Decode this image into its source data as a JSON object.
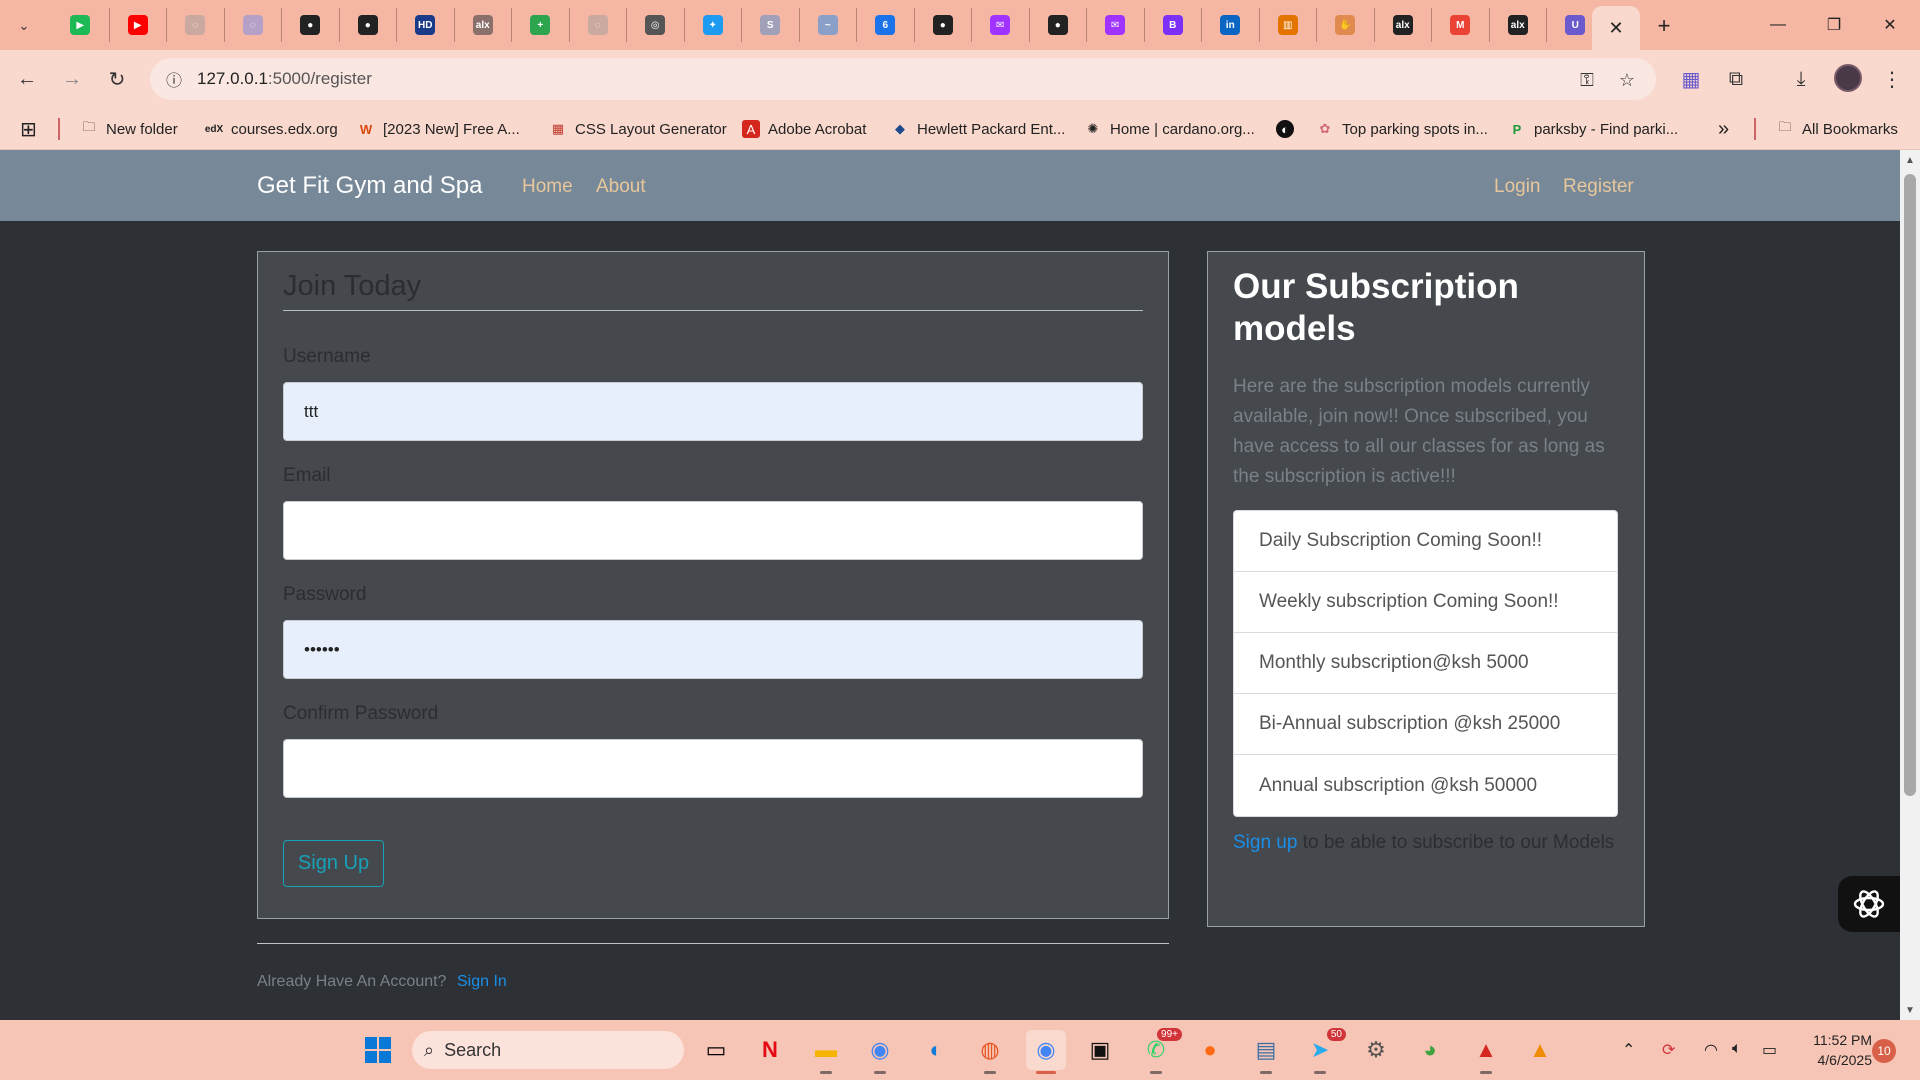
{
  "browser": {
    "tabs": [
      {
        "icon": "play-icon",
        "color": "#1db954"
      },
      {
        "icon": "youtube-icon",
        "color": "#ff0000"
      },
      {
        "icon": "globe-icon",
        "color": "#c9a9a0"
      },
      {
        "icon": "globe-icon",
        "color": "#b5a0c8"
      },
      {
        "icon": "github-icon",
        "color": "#222222"
      },
      {
        "icon": "github-icon",
        "color": "#222222"
      },
      {
        "icon": "hd-icon",
        "color": "#1a3a8a"
      },
      {
        "icon": "alx-icon",
        "color": "#8a6f6a"
      },
      {
        "icon": "plus-icon",
        "color": "#2da44e"
      },
      {
        "icon": "globe-icon",
        "color": "#c9a9a0"
      },
      {
        "icon": "target-icon",
        "color": "#555555"
      },
      {
        "icon": "twitter-icon",
        "color": "#1d9bf0"
      },
      {
        "icon": "s-icon",
        "color": "#a0a0b8"
      },
      {
        "icon": "wave-icon",
        "color": "#8aa0c8"
      },
      {
        "icon": "calendar-icon",
        "color": "#1a73e8"
      },
      {
        "icon": "github-icon",
        "color": "#222222"
      },
      {
        "icon": "messenger-icon",
        "color": "#a033ff"
      },
      {
        "icon": "github-icon",
        "color": "#222222"
      },
      {
        "icon": "messenger-icon",
        "color": "#a033ff"
      },
      {
        "icon": "b-icon",
        "color": "#7b2ff7"
      },
      {
        "icon": "linkedin-icon",
        "color": "#0a66c2"
      },
      {
        "icon": "chart-icon",
        "color": "#e37400"
      },
      {
        "icon": "hand-icon",
        "color": "#e08a50"
      },
      {
        "icon": "alx-icon",
        "color": "#222222"
      },
      {
        "icon": "gmail-icon",
        "color": "#ea4335"
      },
      {
        "icon": "alx-icon",
        "color": "#222222"
      },
      {
        "icon": "u-icon",
        "color": "#6a5acd"
      }
    ],
    "active_tab_close": "✕",
    "new_tab": "+",
    "url_host": "127.0.0.1",
    "url_path": ":5000/register",
    "bookmarks": [
      {
        "label": "New folder",
        "icon": "folder-icon"
      },
      {
        "label": "courses.edx.org",
        "icon": "edx-icon"
      },
      {
        "label": "[2023 New] Free A...",
        "icon": "w-icon"
      },
      {
        "label": "CSS Layout Generator",
        "icon": "grid-icon"
      },
      {
        "label": "Adobe Acrobat",
        "icon": "acrobat-icon"
      },
      {
        "label": "Hewlett Packard Ent...",
        "icon": "hpe-icon"
      },
      {
        "label": "Home | cardano.org...",
        "icon": "cardano-icon"
      },
      {
        "label": "",
        "icon": "circle-icon"
      },
      {
        "label": "Top parking spots in...",
        "icon": "parking-icon"
      },
      {
        "label": "parksby - Find parki...",
        "icon": "p-icon"
      }
    ],
    "more_bookmarks": "»",
    "all_bookmarks": "All Bookmarks"
  },
  "site": {
    "brand": "Get Fit Gym and Spa",
    "nav_home": "Home",
    "nav_about": "About",
    "nav_login": "Login",
    "nav_register": "Register",
    "link_color": "#e8c79a"
  },
  "form": {
    "legend": "Join Today",
    "username_label": "Username",
    "username_value": "ttt",
    "email_label": "Email",
    "email_value": "",
    "password_label": "Password",
    "password_value": "••••••",
    "confirm_label": "Confirm Password",
    "confirm_value": "",
    "submit": "Sign Up",
    "accent": "#17a2b8"
  },
  "account": {
    "text": "Already Have An Account?",
    "link": "Sign In"
  },
  "subscriptions": {
    "title": "Our Subscription models",
    "description": "Here are the subscription models currently available, join now!! Once subscribed, you have access to all our classes for as long as the subscription is active!!!",
    "items": [
      "Daily Subscription Coming Soon!!",
      "Weekly subscription Coming Soon!!",
      "Monthly subscription@ksh 5000",
      "Bi-Annual subscription @ksh 25000",
      "Annual subscription @ksh 50000"
    ],
    "footer_link": "Sign up",
    "footer_text": " to be able to subscribe to our Models"
  },
  "taskbar": {
    "search": "Search",
    "whatsapp_badge": "99+",
    "telegram_badge": "50",
    "time": "11:52 PM",
    "date": "4/6/2025",
    "notifications": "10"
  }
}
